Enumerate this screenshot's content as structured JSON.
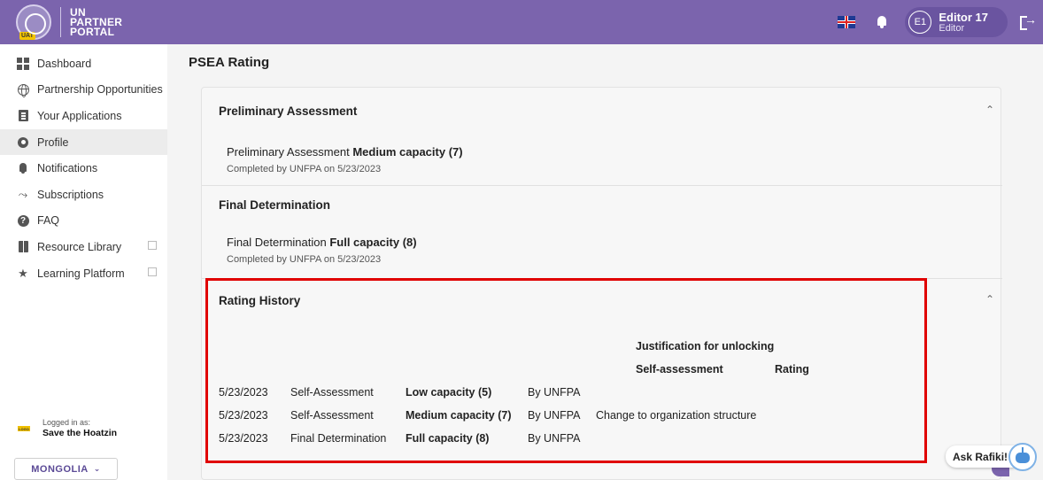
{
  "header": {
    "uat_badge": "UAT",
    "logo_line1": "UN",
    "logo_line2": "PARTNER",
    "logo_line3": "PORTAL",
    "avatar_initials": "E1",
    "user_name": "Editor 17",
    "user_role": "Editor"
  },
  "sidebar": {
    "items": [
      {
        "label": "Dashboard"
      },
      {
        "label": "Partnership Opportunities"
      },
      {
        "label": "Your Applications"
      },
      {
        "label": "Profile"
      },
      {
        "label": "Notifications"
      },
      {
        "label": "Subscriptions"
      },
      {
        "label": "FAQ"
      },
      {
        "label": "Resource Library"
      },
      {
        "label": "Learning Platform"
      }
    ],
    "logo_small": "LOGO",
    "logged_in_label": "Logged in as:",
    "logged_in_org": "Save the Hoatzin",
    "country": "MONGOLIA"
  },
  "main": {
    "page_title": "PSEA Rating",
    "preliminary": {
      "title": "Preliminary Assessment",
      "line_prefix": "Preliminary Assessment ",
      "line_value": "Medium capacity (7)",
      "completed": "Completed by UNFPA on 5/23/2023"
    },
    "final": {
      "title": "Final Determination",
      "line_prefix": "Final Determination ",
      "line_value": "Full capacity (8)",
      "completed": "Completed by UNFPA on 5/23/2023"
    },
    "history": {
      "title": "Rating History",
      "header_justification": "Justification for unlocking",
      "header_self": "Self-assessment",
      "header_rating": "Rating",
      "rows": [
        {
          "date": "5/23/2023",
          "type": "Self-Assessment",
          "rating": "Low capacity (5)",
          "by": "By UNFPA",
          "justification": ""
        },
        {
          "date": "5/23/2023",
          "type": "Self-Assessment",
          "rating": "Medium capacity (7)",
          "by": "By UNFPA",
          "justification": "Change to organization structure"
        },
        {
          "date": "5/23/2023",
          "type": "Final Determination",
          "rating": "Full capacity (8)",
          "by": "By UNFPA",
          "justification": ""
        }
      ]
    }
  },
  "chat": {
    "label": "Ask Rafiki!"
  }
}
